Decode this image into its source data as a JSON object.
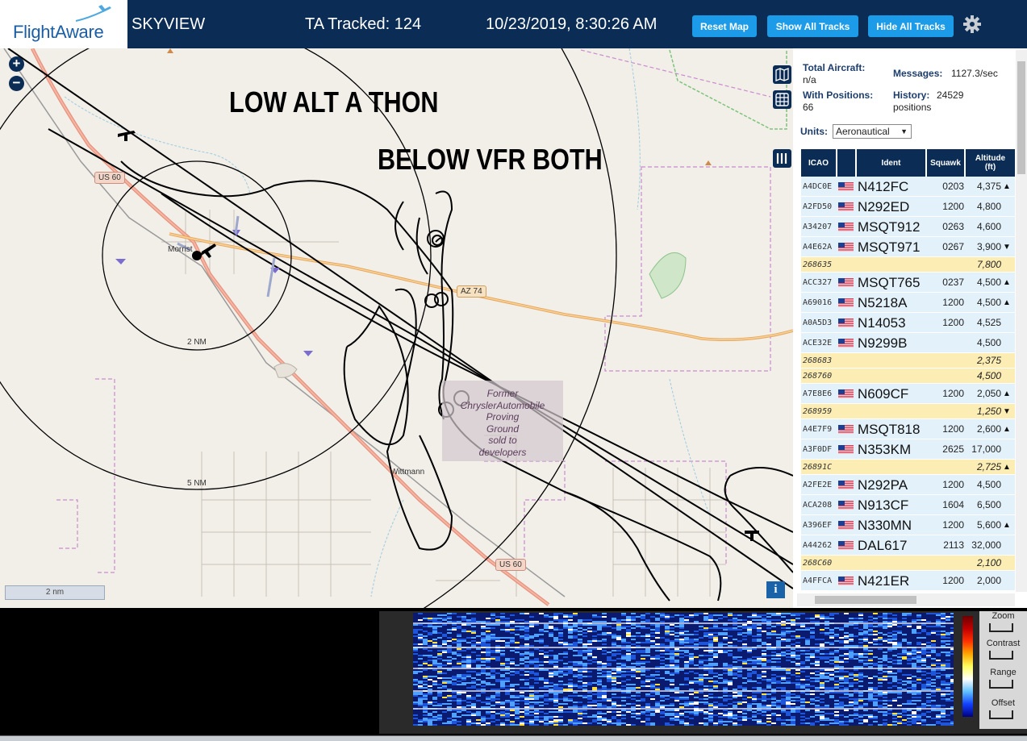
{
  "header": {
    "logo_text": "FlightAware",
    "app_name": "SKYVIEW",
    "tracked": "TA Tracked: 124",
    "datetime": "10/23/2019, 8:30:26 AM",
    "buttons": {
      "reset": "Reset Map",
      "show_all": "Show All Tracks",
      "hide_all": "Hide All Tracks"
    }
  },
  "map": {
    "annotation_1": "LOW ALT A THON",
    "annotation_2": "BELOW VFR BOTH",
    "zoom_in": "+",
    "zoom_out": "−",
    "labels": {
      "us60_a": "US 60",
      "us60_b": "US 60",
      "az74": "AZ 74",
      "morristown": "Morrist",
      "wittmann": "Wittmann",
      "ring_2nm": "2 NM",
      "ring_5nm": "5 NM",
      "proving_ground": "Former\nChryslerAutomobile\nProving\nGround\nsold to\ndevelopers"
    },
    "scale": "2 nm",
    "info": "i"
  },
  "panel": {
    "total_aircraft_label": "Total Aircraft:",
    "total_aircraft_value": "n/a",
    "with_positions_label": "With Positions:",
    "with_positions_value": "66",
    "messages_label": "Messages:",
    "messages_value": "1127.3/sec",
    "history_label": "History:",
    "history_value": "24529",
    "history_unit": "positions",
    "units_label": "Units:",
    "units_value": "Aeronautical",
    "columns": {
      "icao": "ICAO",
      "ident": "Ident",
      "squawk": "Squawk",
      "altitude": "Altitude\n(ft)"
    },
    "rows": [
      {
        "icao": "A4DC0E",
        "flag": true,
        "ident": "N412FC",
        "squawk": "0203",
        "alt": "4,375",
        "trend": "▲",
        "type": "blue"
      },
      {
        "icao": "A2FD50",
        "flag": true,
        "ident": "N292ED",
        "squawk": "1200",
        "alt": "4,800",
        "trend": "",
        "type": "blue"
      },
      {
        "icao": "A34207",
        "flag": true,
        "ident": "MSQT912",
        "squawk": "0263",
        "alt": "4,600",
        "trend": "",
        "type": "blue"
      },
      {
        "icao": "A4E62A",
        "flag": true,
        "ident": "MSQT971",
        "squawk": "0267",
        "alt": "3,900",
        "trend": "▼",
        "type": "blue"
      },
      {
        "icao": "268635",
        "flag": false,
        "ident": "",
        "squawk": "",
        "alt": "7,800",
        "trend": "",
        "type": "yellow"
      },
      {
        "icao": "ACC327",
        "flag": true,
        "ident": "MSQT765",
        "squawk": "0237",
        "alt": "4,500",
        "trend": "▲",
        "type": "blue"
      },
      {
        "icao": "A69016",
        "flag": true,
        "ident": "N5218A",
        "squawk": "1200",
        "alt": "4,500",
        "trend": "▲",
        "type": "blue"
      },
      {
        "icao": "A0A5D3",
        "flag": true,
        "ident": "N14053",
        "squawk": "1200",
        "alt": "4,525",
        "trend": "",
        "type": "blue"
      },
      {
        "icao": "ACE32E",
        "flag": true,
        "ident": "N9299B",
        "squawk": "",
        "alt": "4,500",
        "trend": "",
        "type": "blue"
      },
      {
        "icao": "268683",
        "flag": false,
        "ident": "",
        "squawk": "",
        "alt": "2,375",
        "trend": "",
        "type": "yellow"
      },
      {
        "icao": "268760",
        "flag": false,
        "ident": "",
        "squawk": "",
        "alt": "4,500",
        "trend": "",
        "type": "yellow"
      },
      {
        "icao": "A7E8E6",
        "flag": true,
        "ident": "N609CF",
        "squawk": "1200",
        "alt": "2,050",
        "trend": "▲",
        "type": "blue"
      },
      {
        "icao": "268959",
        "flag": false,
        "ident": "",
        "squawk": "",
        "alt": "1,250",
        "trend": "▼",
        "type": "yellow"
      },
      {
        "icao": "A4E7F9",
        "flag": true,
        "ident": "MSQT818",
        "squawk": "1200",
        "alt": "2,600",
        "trend": "▲",
        "type": "blue"
      },
      {
        "icao": "A3F0DF",
        "flag": true,
        "ident": "N353KM",
        "squawk": "2625",
        "alt": "17,000",
        "trend": "",
        "type": "blue"
      },
      {
        "icao": "26891C",
        "flag": false,
        "ident": "",
        "squawk": "",
        "alt": "2,725",
        "trend": "▲",
        "type": "yellow"
      },
      {
        "icao": "A2FE2E",
        "flag": true,
        "ident": "N292PA",
        "squawk": "1200",
        "alt": "4,500",
        "trend": "",
        "type": "blue"
      },
      {
        "icao": "ACA208",
        "flag": true,
        "ident": "N913CF",
        "squawk": "1604",
        "alt": "6,500",
        "trend": "",
        "type": "blue"
      },
      {
        "icao": "A396EF",
        "flag": true,
        "ident": "N330MN",
        "squawk": "1200",
        "alt": "5,600",
        "trend": "▲",
        "type": "blue"
      },
      {
        "icao": "A44262",
        "flag": true,
        "ident": "DAL617",
        "squawk": "2113",
        "alt": "32,000",
        "trend": "",
        "type": "blue"
      },
      {
        "icao": "268C60",
        "flag": false,
        "ident": "",
        "squawk": "",
        "alt": "2,100",
        "trend": "",
        "type": "yellow"
      },
      {
        "icao": "A4FFCA",
        "flag": true,
        "ident": "N421ER",
        "squawk": "1200",
        "alt": "2,000",
        "trend": "",
        "type": "blue"
      }
    ]
  },
  "waterfall": {
    "controls": [
      "Zoom",
      "Contrast",
      "Range",
      "Offset"
    ]
  },
  "colors": {
    "header_bg": "#0b2d55",
    "button_bg": "#1b9be8",
    "row_blue": "#e3f1fa",
    "row_yellow": "#fcedb4"
  }
}
